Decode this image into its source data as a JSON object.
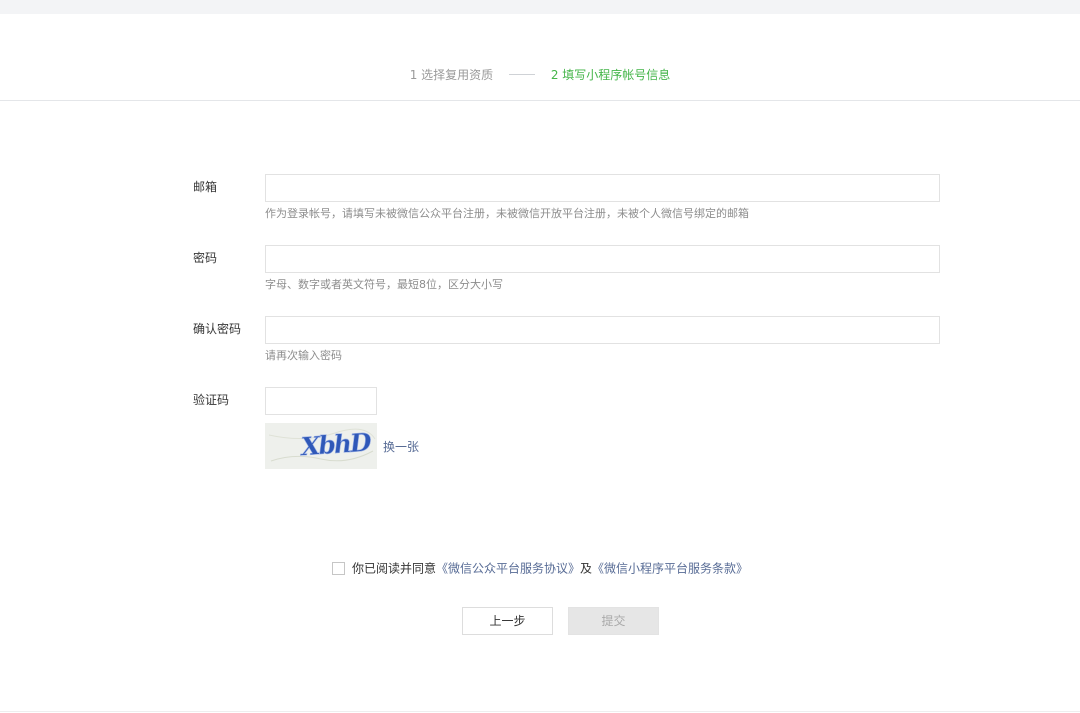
{
  "steps": [
    {
      "label": "1 选择复用资质",
      "state": "done"
    },
    {
      "label": "2 填写小程序帐号信息",
      "state": "active"
    }
  ],
  "form": {
    "email": {
      "label": "邮箱",
      "value": "",
      "tip": "作为登录帐号，请填写未被微信公众平台注册，未被微信开放平台注册，未被个人微信号绑定的邮箱"
    },
    "password": {
      "label": "密码",
      "value": "",
      "tip": "字母、数字或者英文符号，最短8位，区分大小写"
    },
    "confirm_password": {
      "label": "确认密码",
      "value": "",
      "tip": "请再次输入密码"
    },
    "captcha": {
      "label": "验证码",
      "value": "",
      "image_text": "XbhD",
      "refresh_label": "换一张"
    }
  },
  "agreement": {
    "checked": false,
    "text": "你已阅读并同意",
    "link1": "《微信公众平台服务协议》",
    "and": "及",
    "link2": "《微信小程序平台服务条款》"
  },
  "buttons": {
    "prev_label": "上一步",
    "submit_label": "提交",
    "submit_disabled": true
  },
  "colors": {
    "active_step": "#44b549",
    "link": "#576b95",
    "captcha_text": "#2f58b8"
  }
}
